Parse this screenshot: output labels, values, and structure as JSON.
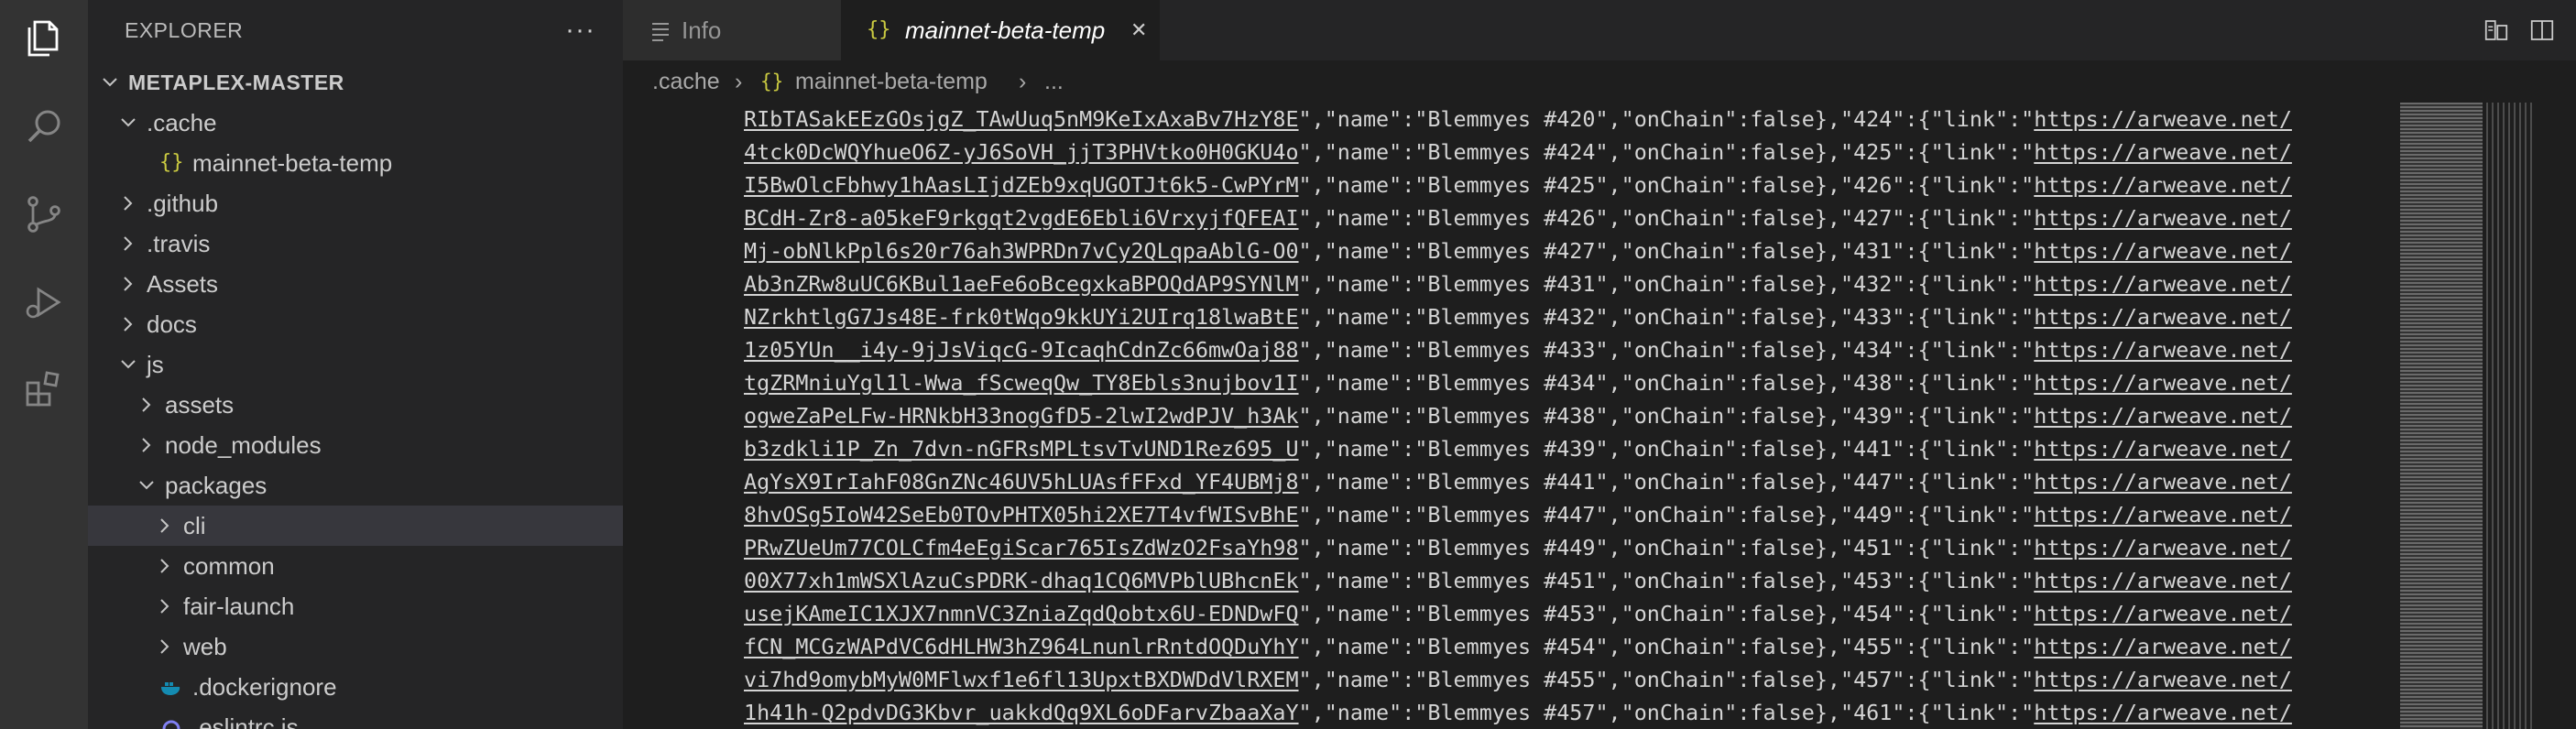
{
  "sidebar": {
    "title": "EXPLORER",
    "more": "···",
    "tree": [
      {
        "label": "METAPLEX-MASTER",
        "depth": 0,
        "type": "root",
        "expanded": true
      },
      {
        "label": ".cache",
        "depth": 1,
        "type": "folder",
        "expanded": true
      },
      {
        "label": "mainnet-beta-temp",
        "depth": 2,
        "type": "json"
      },
      {
        "label": ".github",
        "depth": 1,
        "type": "folder",
        "expanded": false
      },
      {
        "label": ".travis",
        "depth": 1,
        "type": "folder",
        "expanded": false
      },
      {
        "label": "Assets",
        "depth": 1,
        "type": "folder",
        "expanded": false
      },
      {
        "label": "docs",
        "depth": 1,
        "type": "folder",
        "expanded": false
      },
      {
        "label": "js",
        "depth": 1,
        "type": "folder",
        "expanded": true
      },
      {
        "label": "assets",
        "depth": 2,
        "type": "folder",
        "expanded": false
      },
      {
        "label": "node_modules",
        "depth": 2,
        "type": "folder",
        "expanded": false
      },
      {
        "label": "packages",
        "depth": 2,
        "type": "folder",
        "expanded": true
      },
      {
        "label": "cli",
        "depth": 3,
        "type": "folder",
        "expanded": false,
        "selected": true
      },
      {
        "label": "common",
        "depth": 3,
        "type": "folder",
        "expanded": false
      },
      {
        "label": "fair-launch",
        "depth": 3,
        "type": "folder",
        "expanded": false
      },
      {
        "label": "web",
        "depth": 3,
        "type": "folder",
        "expanded": false
      },
      {
        "label": ".dockerignore",
        "depth": 2,
        "type": "docker"
      },
      {
        "label": ".eslintrc.js",
        "depth": 2,
        "type": "eslint"
      }
    ]
  },
  "tabs": [
    {
      "label": "Info",
      "icon": "list-icon",
      "active": false
    },
    {
      "label": "mainnet-beta-temp",
      "icon": "json-icon",
      "active": true,
      "close": "✕"
    }
  ],
  "breadcrumb": {
    "part1": ".cache",
    "part2": "mainnet-beta-temp",
    "part3": "...",
    "sep": "›"
  },
  "code_lines": [
    {
      "pre": "RIbTASakEEzGOsjgZ_TAwUuq5nM9KeIxAxaBv7HzY8E",
      "post": "\",\"name\":\"Blemmyes #420\",\"onChain\":false},\"424\":{\"link\":\"",
      "link": "https://arweave.net/"
    },
    {
      "pre": "4tck0DcWQYhueO6Z-yJ6SoVH_jjT3PHVtko0H0GKU4o",
      "post": "\",\"name\":\"Blemmyes #424\",\"onChain\":false},\"425\":{\"link\":\"",
      "link": "https://arweave.net/"
    },
    {
      "pre": "I5BwOlcFbhwy1hAasLIjdZEb9xqUGOTJt6k5-CwPYrM",
      "post": "\",\"name\":\"Blemmyes #425\",\"onChain\":false},\"426\":{\"link\":\"",
      "link": "https://arweave.net/"
    },
    {
      "pre": "BCdH-Zr8-a05keF9rkgqt2vgdE6Ebli6VrxyjfQFEAI",
      "post": "\",\"name\":\"Blemmyes #426\",\"onChain\":false},\"427\":{\"link\":\"",
      "link": "https://arweave.net/"
    },
    {
      "pre": "Mj-obNlkPpl6s20r76ah3WPRDn7vCy2QLqpaAblG-O0",
      "post": "\",\"name\":\"Blemmyes #427\",\"onChain\":false},\"431\":{\"link\":\"",
      "link": "https://arweave.net/"
    },
    {
      "pre": "Ab3nZRw8uUC6KBul1aeFe6oBcegxkaBPOQdAP9SYNlM",
      "post": "\",\"name\":\"Blemmyes #431\",\"onChain\":false},\"432\":{\"link\":\"",
      "link": "https://arweave.net/"
    },
    {
      "pre": "NZrkhtlgG7Js48E-frk0tWqo9kkUYi2UIrq18lwaBtE",
      "post": "\",\"name\":\"Blemmyes #432\",\"onChain\":false},\"433\":{\"link\":\"",
      "link": "https://arweave.net/"
    },
    {
      "pre": "1z05YUn__i4y-9jJsViqcG-9IcaqhCdnZc66mwOaj88",
      "post": "\",\"name\":\"Blemmyes #433\",\"onChain\":false},\"434\":{\"link\":\"",
      "link": "https://arweave.net/"
    },
    {
      "pre": "tgZRMniuYgl1l-Wwa_fScweqQw_TY8Ebls3nujbov1I",
      "post": "\",\"name\":\"Blemmyes #434\",\"onChain\":false},\"438\":{\"link\":\"",
      "link": "https://arweave.net/"
    },
    {
      "pre": "ogweZaPeLFw-HRNkbH33nogGfD5-2lwI2wdPJV_h3Ak",
      "post": "\",\"name\":\"Blemmyes #438\",\"onChain\":false},\"439\":{\"link\":\"",
      "link": "https://arweave.net/"
    },
    {
      "pre": "b3zdkli1P_Zn_7dvn-nGFRsMPLtsvTvUND1Rez695_U",
      "post": "\",\"name\":\"Blemmyes #439\",\"onChain\":false},\"441\":{\"link\":\"",
      "link": "https://arweave.net/"
    },
    {
      "pre": "AgYsX9IrIahF08GnZNc46UV5hLUAsfFFxd_YF4UBMj8",
      "post": "\",\"name\":\"Blemmyes #441\",\"onChain\":false},\"447\":{\"link\":\"",
      "link": "https://arweave.net/"
    },
    {
      "pre": "8hvOSg5IoW42SeEb0TOvPHTX05hi2XE7T4vfWISvBhE",
      "post": "\",\"name\":\"Blemmyes #447\",\"onChain\":false},\"449\":{\"link\":\"",
      "link": "https://arweave.net/"
    },
    {
      "pre": "PRwZUeUm77COLCfm4eEgiScar765IsZdWzO2FsaYh98",
      "post": "\",\"name\":\"Blemmyes #449\",\"onChain\":false},\"451\":{\"link\":\"",
      "link": "https://arweave.net/"
    },
    {
      "pre": "00X77xh1mWSXlAzuCsPDRK-dhaq1CQ6MVPblUBhcnEk",
      "post": "\",\"name\":\"Blemmyes #451\",\"onChain\":false},\"453\":{\"link\":\"",
      "link": "https://arweave.net/"
    },
    {
      "pre": "usejKAmeIC1XJX7nmnVC3ZniaZqdQobtx6U-EDNDwFQ",
      "post": "\",\"name\":\"Blemmyes #453\",\"onChain\":false},\"454\":{\"link\":\"",
      "link": "https://arweave.net/"
    },
    {
      "pre": "fCN_MCGzWAPdVC6dHLHW3hZ964LnunlrRntdOQDuYhY",
      "post": "\",\"name\":\"Blemmyes #454\",\"onChain\":false},\"455\":{\"link\":\"",
      "link": "https://arweave.net/"
    },
    {
      "pre": "vi7hd9omybMyW0MFlwxf1e6fl13UpxtBXDWDdVlRXEM",
      "post": "\",\"name\":\"Blemmyes #455\",\"onChain\":false},\"457\":{\"link\":\"",
      "link": "https://arweave.net/"
    },
    {
      "pre": "1h41h-Q2pdvDG3Kbvr_uakkdQq9XL6oDFarvZbaaXaY",
      "post": "\",\"name\":\"Blemmyes #457\",\"onChain\":false},\"461\":{\"link\":\"",
      "link": "https://arweave.net/"
    }
  ],
  "colors": {
    "json_icon": "#cbcb41",
    "docker_icon": "#0db7ed",
    "eslint_icon": "#8080f2"
  }
}
